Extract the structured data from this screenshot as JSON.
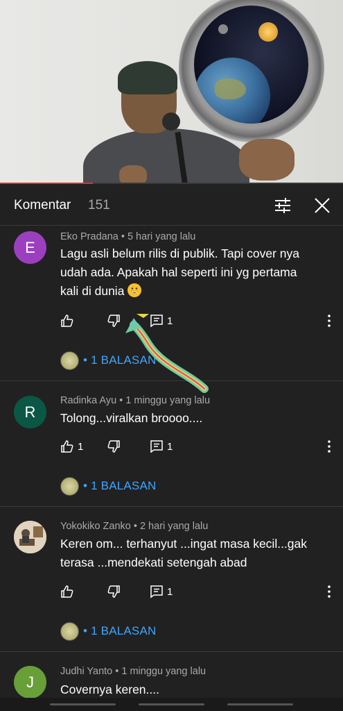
{
  "video": {
    "progress_fraction": 0.27
  },
  "header": {
    "title": "Komentar",
    "count": "151"
  },
  "comments": [
    {
      "avatar_letter": "E",
      "avatar_color": "#9c3fbf",
      "meta": "Eko Pradana • 5 hari yang lalu",
      "text_lines": [
        "Lagu asli belum rilis di publik. Tapi cover nya",
        "udah ada. Apakah hal seperti ini yg pertama",
        "kali di dunia"
      ],
      "like_count": "",
      "reply_count": "1",
      "replies_label": "• 1 BALASAN"
    },
    {
      "avatar_letter": "R",
      "avatar_color": "#0b5745",
      "meta": "Radinka Ayu • 1 minggu yang lalu",
      "text_lines": [
        "Tolong...viralkan broooo...."
      ],
      "like_count": "1",
      "reply_count": "1",
      "replies_label": "• 1 BALASAN"
    },
    {
      "avatar_letter": "",
      "avatar_color": "#c9b59a",
      "meta": "Yokokiko Zanko • 2 hari yang lalu",
      "text_lines": [
        "Keren om... terhanyut ...ingat masa kecil...gak",
        "terasa ...mendekati setengah abad"
      ],
      "like_count": "",
      "reply_count": "1",
      "replies_label": "• 1 BALASAN"
    },
    {
      "avatar_letter": "J",
      "avatar_color": "#689f38",
      "meta": "Judhi Yanto • 1 minggu yang lalu",
      "text_lines": [
        "Covernya keren...."
      ]
    }
  ]
}
